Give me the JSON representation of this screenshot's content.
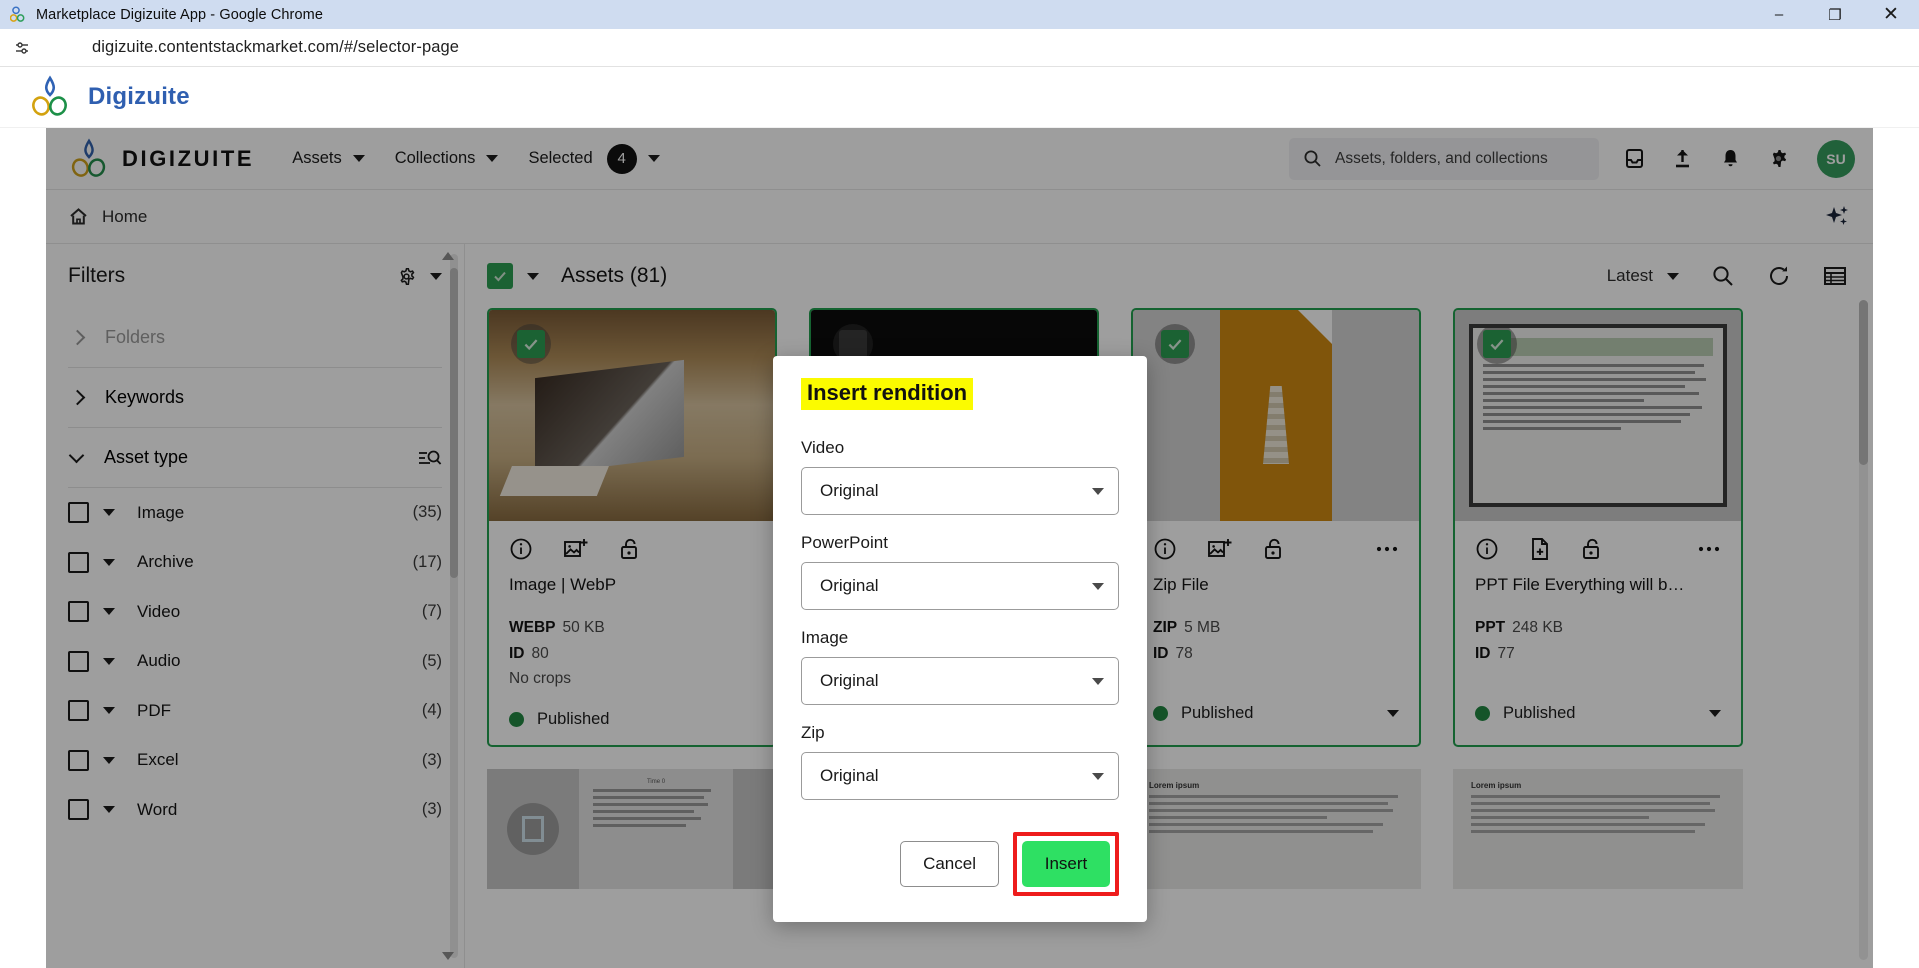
{
  "browser": {
    "window_title": "Marketplace Digizuite App - Google Chrome",
    "url": "digizuite.contentstackmarket.com/#/selector-page",
    "minimize_label": "–",
    "maximize_label": "❐",
    "close_label": "✕"
  },
  "app_bar": {
    "title": "Digizuite"
  },
  "header": {
    "wordmark": "DIGIZUITE",
    "nav": [
      {
        "label": "Assets"
      },
      {
        "label": "Collections"
      }
    ],
    "selected": {
      "label": "Selected",
      "count": "4"
    },
    "search_placeholder": "Assets, folders, and collections",
    "avatar_initials": "SU"
  },
  "breadcrumb": {
    "home": "Home"
  },
  "filters": {
    "title": "Filters",
    "groups": [
      {
        "label": "Folders",
        "state": "collapsed",
        "dimmed": true
      },
      {
        "label": "Keywords",
        "state": "collapsed",
        "dimmed": false
      },
      {
        "label": "Asset type",
        "state": "expanded",
        "dimmed": false
      }
    ],
    "asset_types": [
      {
        "label": "Image",
        "count": "(35)"
      },
      {
        "label": "Archive",
        "count": "(17)"
      },
      {
        "label": "Video",
        "count": "(7)"
      },
      {
        "label": "Audio",
        "count": "(5)"
      },
      {
        "label": "PDF",
        "count": "(4)"
      },
      {
        "label": "Excel",
        "count": "(3)"
      },
      {
        "label": "Word",
        "count": "(3)"
      }
    ]
  },
  "assets": {
    "toolbar": {
      "title": "Assets (81)",
      "sort_label": "Latest"
    },
    "cards": [
      {
        "name": "Image | WebP",
        "format_key": "WEBP",
        "format_value": "50 KB",
        "id_key": "ID",
        "id_value": "80",
        "crops": "No crops",
        "status": "Published",
        "thumb": "desk-photo",
        "selected": true
      },
      {
        "name": "",
        "format_key": "",
        "format_value": "",
        "id_key": "",
        "id_value": "",
        "crops": "",
        "status": "",
        "thumb": "dark",
        "selected": false
      },
      {
        "name": "Zip File",
        "format_key": "ZIP",
        "format_value": "5 MB",
        "id_key": "ID",
        "id_value": "78",
        "crops": "",
        "status": "Published",
        "thumb": "zip",
        "selected": true
      },
      {
        "name": "PPT File Everything will b…",
        "format_key": "PPT",
        "format_value": "248 KB",
        "id_key": "ID",
        "id_value": "77",
        "crops": "",
        "status": "Published",
        "thumb": "ppt-doc",
        "selected": true
      }
    ],
    "strip_labels": {
      "table_title": "Time 0",
      "lorem_heading": "Lorem ipsum"
    }
  },
  "modal": {
    "title": "Insert rendition",
    "fields": [
      {
        "label": "Video",
        "value": "Original"
      },
      {
        "label": "PowerPoint",
        "value": "Original"
      },
      {
        "label": "Image",
        "value": "Original"
      },
      {
        "label": "Zip",
        "value": "Original"
      }
    ],
    "cancel_label": "Cancel",
    "insert_label": "Insert"
  },
  "colors": {
    "highlight_yellow": "#fbfb00",
    "insert_green": "#2ee063",
    "attention_red": "#ee1c1c",
    "selection_green": "#1aa34a",
    "published_green": "#1b8a3e",
    "brand_blue": "#2f5fb0"
  }
}
